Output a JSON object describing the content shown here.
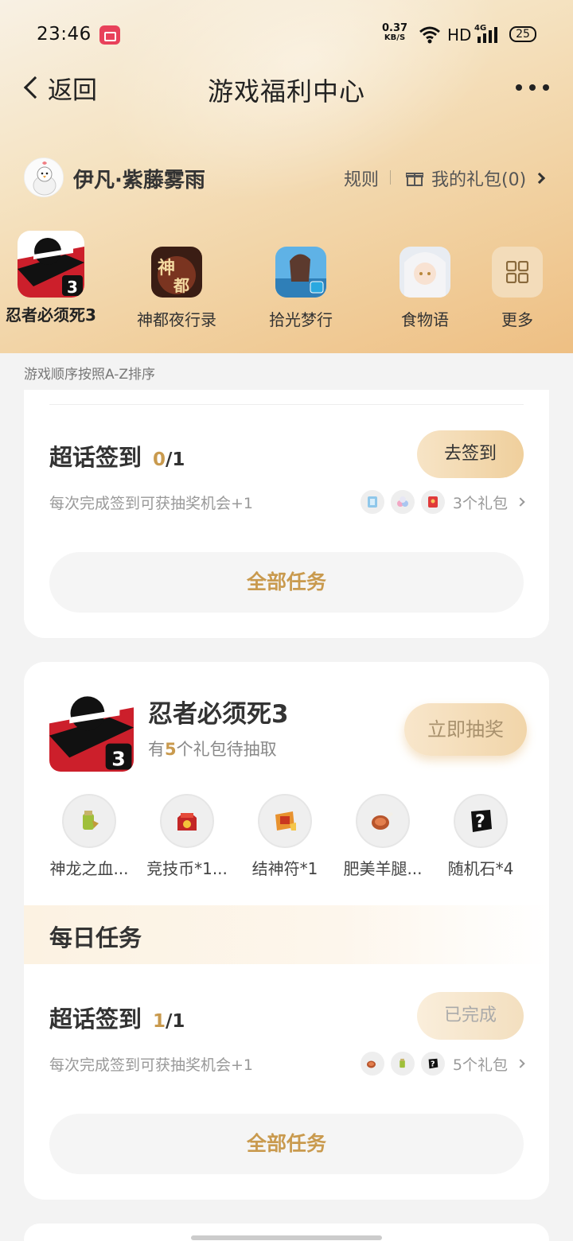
{
  "status_bar": {
    "time": "23:46",
    "net_speed": "0.37",
    "net_unit": "KB/S",
    "network": "HD",
    "network_gen": "4G",
    "battery": "25"
  },
  "nav": {
    "back_label": "返回",
    "title": "游戏福利中心"
  },
  "user": {
    "name": "伊凡·紫藤雾雨",
    "rules_label": "规则",
    "my_gifts_label": "我的礼包(0)"
  },
  "games": [
    {
      "label": "忍者必须死3"
    },
    {
      "label": "神都夜行录"
    },
    {
      "label": "拾光梦行"
    },
    {
      "label": "食物语"
    },
    {
      "label": "更多"
    }
  ],
  "sort_hint": "游戏顺序按照A-Z排序",
  "card1": {
    "task": {
      "title": "超话签到",
      "progress_current": "0",
      "progress_total": "/1",
      "desc": "每次完成签到可获抽奖机会+1",
      "button": "去签到",
      "gift_count": "3个礼包"
    },
    "all_tasks": "全部任务"
  },
  "card2": {
    "game_name": "忍者必须死3",
    "sub_prefix": "有",
    "sub_count": "5",
    "sub_suffix": "个礼包待抽取",
    "draw_button": "立即抽奖",
    "prizes": [
      {
        "label": "神龙之血..."
      },
      {
        "label": "竞技币*1..."
      },
      {
        "label": "结神符*1"
      },
      {
        "label": "肥美羊腿..."
      },
      {
        "label": "随机石*4"
      }
    ],
    "daily_title": "每日任务",
    "task": {
      "title": "超话签到",
      "progress_current": "1",
      "progress_total": "/1",
      "desc": "每次完成签到可获抽奖机会+1",
      "button": "已完成",
      "gift_count": "5个礼包"
    },
    "all_tasks": "全部任务"
  },
  "colors": {
    "accent": "#c99a4e",
    "pill_start": "#f7e4c6",
    "pill_end": "#efcf9c"
  }
}
